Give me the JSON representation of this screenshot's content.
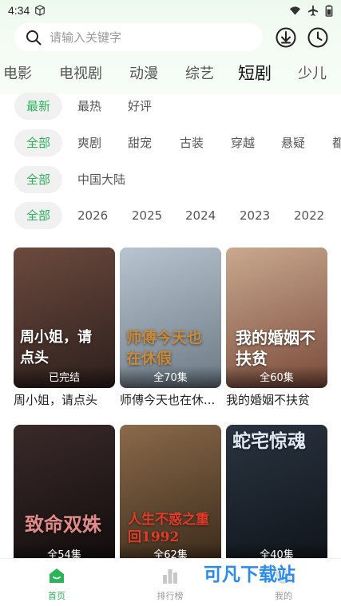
{
  "status": {
    "time": "4:34"
  },
  "search": {
    "placeholder": "请输入关键字"
  },
  "category_tabs": [
    "电影",
    "电视剧",
    "动漫",
    "综艺",
    "短剧",
    "少儿"
  ],
  "active_category": "短剧",
  "filters": {
    "sort": [
      "最新",
      "最热",
      "好评"
    ],
    "genre": [
      "全部",
      "爽剧",
      "甜宠",
      "古装",
      "穿越",
      "悬疑",
      "都"
    ],
    "region": [
      "全部",
      "中国大陆"
    ],
    "year": [
      "全部",
      "2026",
      "2025",
      "2024",
      "2023",
      "2022"
    ]
  },
  "dramas": [
    {
      "title": "周小姐，请点头",
      "badge": "已完结",
      "poster_text": "周小姐，请点头",
      "colors": [
        "#6b4a3e",
        "#2d1f1c"
      ]
    },
    {
      "title": "师傅今天也在休...",
      "badge": "全70集",
      "poster_text": "师傅今天也在休假",
      "colors": [
        "#b8c4cf",
        "#6c7a86"
      ]
    },
    {
      "title": "我的婚姻不扶贫",
      "badge": "全60集",
      "poster_text": "我的婚姻不扶贫",
      "colors": [
        "#c9a98f",
        "#7a4a3a"
      ]
    },
    {
      "title": "",
      "badge": "全54集",
      "poster_text": "致命双姝",
      "colors": [
        "#3a2a2a",
        "#120c0c"
      ]
    },
    {
      "title": "",
      "badge": "全62集",
      "poster_text": "人生不惑之重回1992",
      "colors": [
        "#8a6a4a",
        "#3a2a1a"
      ]
    },
    {
      "title": "",
      "badge": "全40集",
      "poster_text": "蛇宅惊魂",
      "colors": [
        "#2a3440",
        "#0f141a"
      ]
    }
  ],
  "bottom_nav": [
    {
      "label": "首页",
      "icon": "home-icon",
      "active": true
    },
    {
      "label": "排行榜",
      "icon": "bar-chart-icon",
      "active": false
    },
    {
      "label": "我的",
      "icon": "profile-icon",
      "active": false
    }
  ],
  "watermark": "可凡下载站",
  "colors": {
    "accent": "#2db35a",
    "header_bg": "#f2fbf2"
  }
}
